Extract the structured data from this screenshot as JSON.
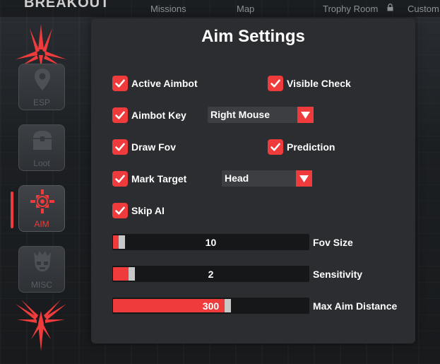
{
  "app": {
    "game_title": "BREAKOUT",
    "nav": [
      "Missions",
      "Map",
      "Trophy Room",
      "Custom"
    ]
  },
  "sidebar": {
    "items": [
      {
        "label": "ESP",
        "icon": "map-pin-icon",
        "active": false
      },
      {
        "label": "Loot",
        "icon": "chest-icon",
        "active": false
      },
      {
        "label": "AIM",
        "icon": "crosshair-target-icon",
        "active": true
      },
      {
        "label": "MISC",
        "icon": "skull-icon",
        "active": false
      }
    ]
  },
  "panel": {
    "title": "Aim Settings",
    "checkboxes": {
      "active_aimbot": {
        "label": "Active Aimbot",
        "checked": true
      },
      "visible_check": {
        "label": "Visible Check",
        "checked": true
      },
      "aimbot_key": {
        "label": "Aimbot Key",
        "checked": true
      },
      "draw_fov": {
        "label": "Draw Fov",
        "checked": true
      },
      "prediction": {
        "label": "Prediction",
        "checked": true
      },
      "mark_target": {
        "label": "Mark Target",
        "checked": true
      },
      "skip_ai": {
        "label": "Skip AI",
        "checked": true
      }
    },
    "dropdowns": {
      "aimbot_key": {
        "value": "Right Mouse"
      },
      "mark_target": {
        "value": "Head"
      }
    },
    "sliders": {
      "fov_size": {
        "label": "Fov Size",
        "value": "10",
        "fraction": 0.03
      },
      "sensitivity": {
        "label": "Sensitivity",
        "value": "2",
        "fraction": 0.08
      },
      "max_aim_distance": {
        "label": "Max Aim Distance",
        "value": "300",
        "fraction": 0.57
      }
    }
  },
  "colors": {
    "accent": "#ef3b3b",
    "panel_bg": "#2b2d30",
    "track_bg": "#161718"
  }
}
